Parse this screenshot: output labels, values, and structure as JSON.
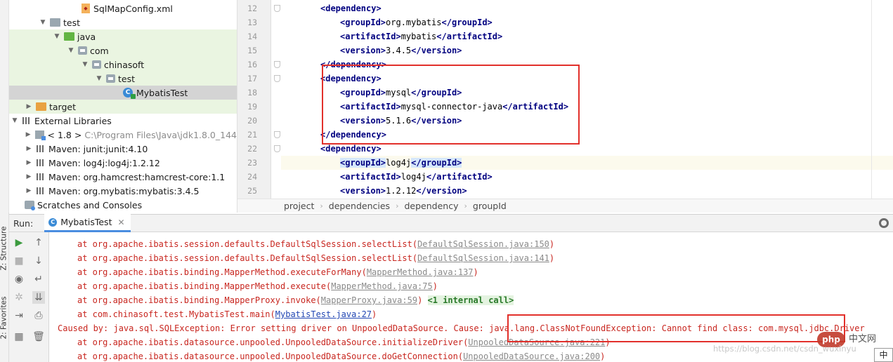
{
  "project_tree": {
    "items": [
      {
        "label": "SqlMapConfig.xml"
      },
      {
        "label": "test"
      },
      {
        "label": "java"
      },
      {
        "label": "com"
      },
      {
        "label": "chinasoft"
      },
      {
        "label": "test"
      },
      {
        "label": "MybatisTest"
      },
      {
        "label": "target"
      },
      {
        "label": "External Libraries"
      },
      {
        "label": "< 1.8 >",
        "detail": "C:\\Program Files\\Java\\jdk1.8.0_144"
      },
      {
        "label": "Maven: junit:junit:4.10"
      },
      {
        "label": "Maven: log4j:log4j:1.2.12"
      },
      {
        "label": "Maven: org.hamcrest:hamcrest-core:1.1"
      },
      {
        "label": "Maven: org.mybatis:mybatis:3.4.5"
      },
      {
        "label": "Scratches and Consoles"
      }
    ]
  },
  "editor": {
    "line_numbers": [
      "12",
      "13",
      "14",
      "15",
      "16",
      "17",
      "18",
      "19",
      "20",
      "21",
      "22",
      "23",
      "24",
      "25"
    ],
    "lines": [
      {
        "open": "<dependency>",
        "text": "",
        "close": ""
      },
      {
        "open": "<groupId>",
        "text": "org.mybatis",
        "close": "</groupId>"
      },
      {
        "open": "<artifactId>",
        "text": "mybatis",
        "close": "</artifactId>"
      },
      {
        "open": "<version>",
        "text": "3.4.5",
        "close": "</version>"
      },
      {
        "open": "</dependency>",
        "text": "",
        "close": ""
      },
      {
        "open": "<dependency>",
        "text": "",
        "close": ""
      },
      {
        "open": "<groupId>",
        "text": "mysql",
        "close": "</groupId>"
      },
      {
        "open": "<artifactId>",
        "text": "mysql-connector-java",
        "close": "</artifactId>"
      },
      {
        "open": "<version>",
        "text": "5.1.6",
        "close": "</version>"
      },
      {
        "open": "</dependency>",
        "text": "",
        "close": ""
      },
      {
        "open": "<dependency>",
        "text": "",
        "close": ""
      },
      {
        "open": "<groupId>",
        "text": "log4j",
        "close": "</groupId>"
      },
      {
        "open": "<artifactId>",
        "text": "log4j",
        "close": "</artifactId>"
      },
      {
        "open": "<version>",
        "text": "1.2.12",
        "close": "</version>"
      }
    ]
  },
  "breadcrumb": [
    "project",
    "dependencies",
    "dependency",
    "groupId"
  ],
  "run_panel": {
    "label": "Run:",
    "tab": "MybatisTest",
    "left_tabs": [
      "Z: Structure",
      "2: Favorites"
    ]
  },
  "console": {
    "lines": [
      {
        "prefix": "at org.apache.ibatis.session.defaults.DefaultSqlSession.selectList(",
        "link": "DefaultSqlSession.java:150",
        "suffix": ")"
      },
      {
        "prefix": "at org.apache.ibatis.session.defaults.DefaultSqlSession.selectList(",
        "link": "DefaultSqlSession.java:141",
        "suffix": ")"
      },
      {
        "prefix": "at org.apache.ibatis.binding.MapperMethod.executeForMany(",
        "link": "MapperMethod.java:137",
        "suffix": ")"
      },
      {
        "prefix": "at org.apache.ibatis.binding.MapperMethod.execute(",
        "link": "MapperMethod.java:75",
        "suffix": ")"
      },
      {
        "prefix": "at org.apache.ibatis.binding.MapperProxy.invoke(",
        "link": "MapperProxy.java:59",
        "suffix": ") ",
        "note": "<1 internal call>"
      },
      {
        "prefix": "at com.chinasoft.test.MybatisTest.main(",
        "link": "MybatisTest.java:27",
        "suffix": ")"
      },
      {
        "prefix": "Caused by: java.sql.SQLException: Error setting driver on UnpooledDataSource. Cause: java.lang.ClassNotFoundException: Cannot find class: com.mysql.jdbc.Driver",
        "link": "",
        "suffix": ""
      },
      {
        "prefix": "at org.apache.ibatis.datasource.unpooled.UnpooledDataSource.initializeDriver(",
        "link": "UnpooledDataSource.java:221",
        "suffix": ")"
      },
      {
        "prefix": "at org.apache.ibatis.datasource.unpooled.UnpooledDataSource.doGetConnection(",
        "link": "UnpooledDataSource.java:200",
        "suffix": ")"
      }
    ]
  },
  "watermark": {
    "logo": "php",
    "text": "中文网",
    "url": "https://blog.csdn.net/csdn_wuxinyu"
  },
  "ime_indicator": "中",
  "colors": {
    "highlight_box": "#e2302b",
    "tag": "#000080",
    "error": "#c8261f",
    "selection": "#d4d4d4",
    "source_root": "#eaf5e1"
  }
}
